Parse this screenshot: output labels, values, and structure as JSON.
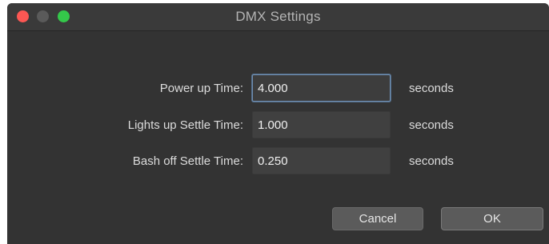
{
  "window": {
    "title": "DMX Settings"
  },
  "fields": [
    {
      "label": "Power up Time:",
      "value": "4.000",
      "unit": "seconds",
      "focused": true
    },
    {
      "label": "Lights up Settle Time:",
      "value": "1.000",
      "unit": "seconds",
      "focused": false
    },
    {
      "label": "Bash off Settle Time:",
      "value": "0.250",
      "unit": "seconds",
      "focused": false
    }
  ],
  "buttons": {
    "cancel_label": "Cancel",
    "ok_label": "OK"
  },
  "colors": {
    "close": "#fc5753",
    "minimize": "#5a5a5a",
    "maximize": "#34c84a",
    "window_bg": "#333333"
  }
}
